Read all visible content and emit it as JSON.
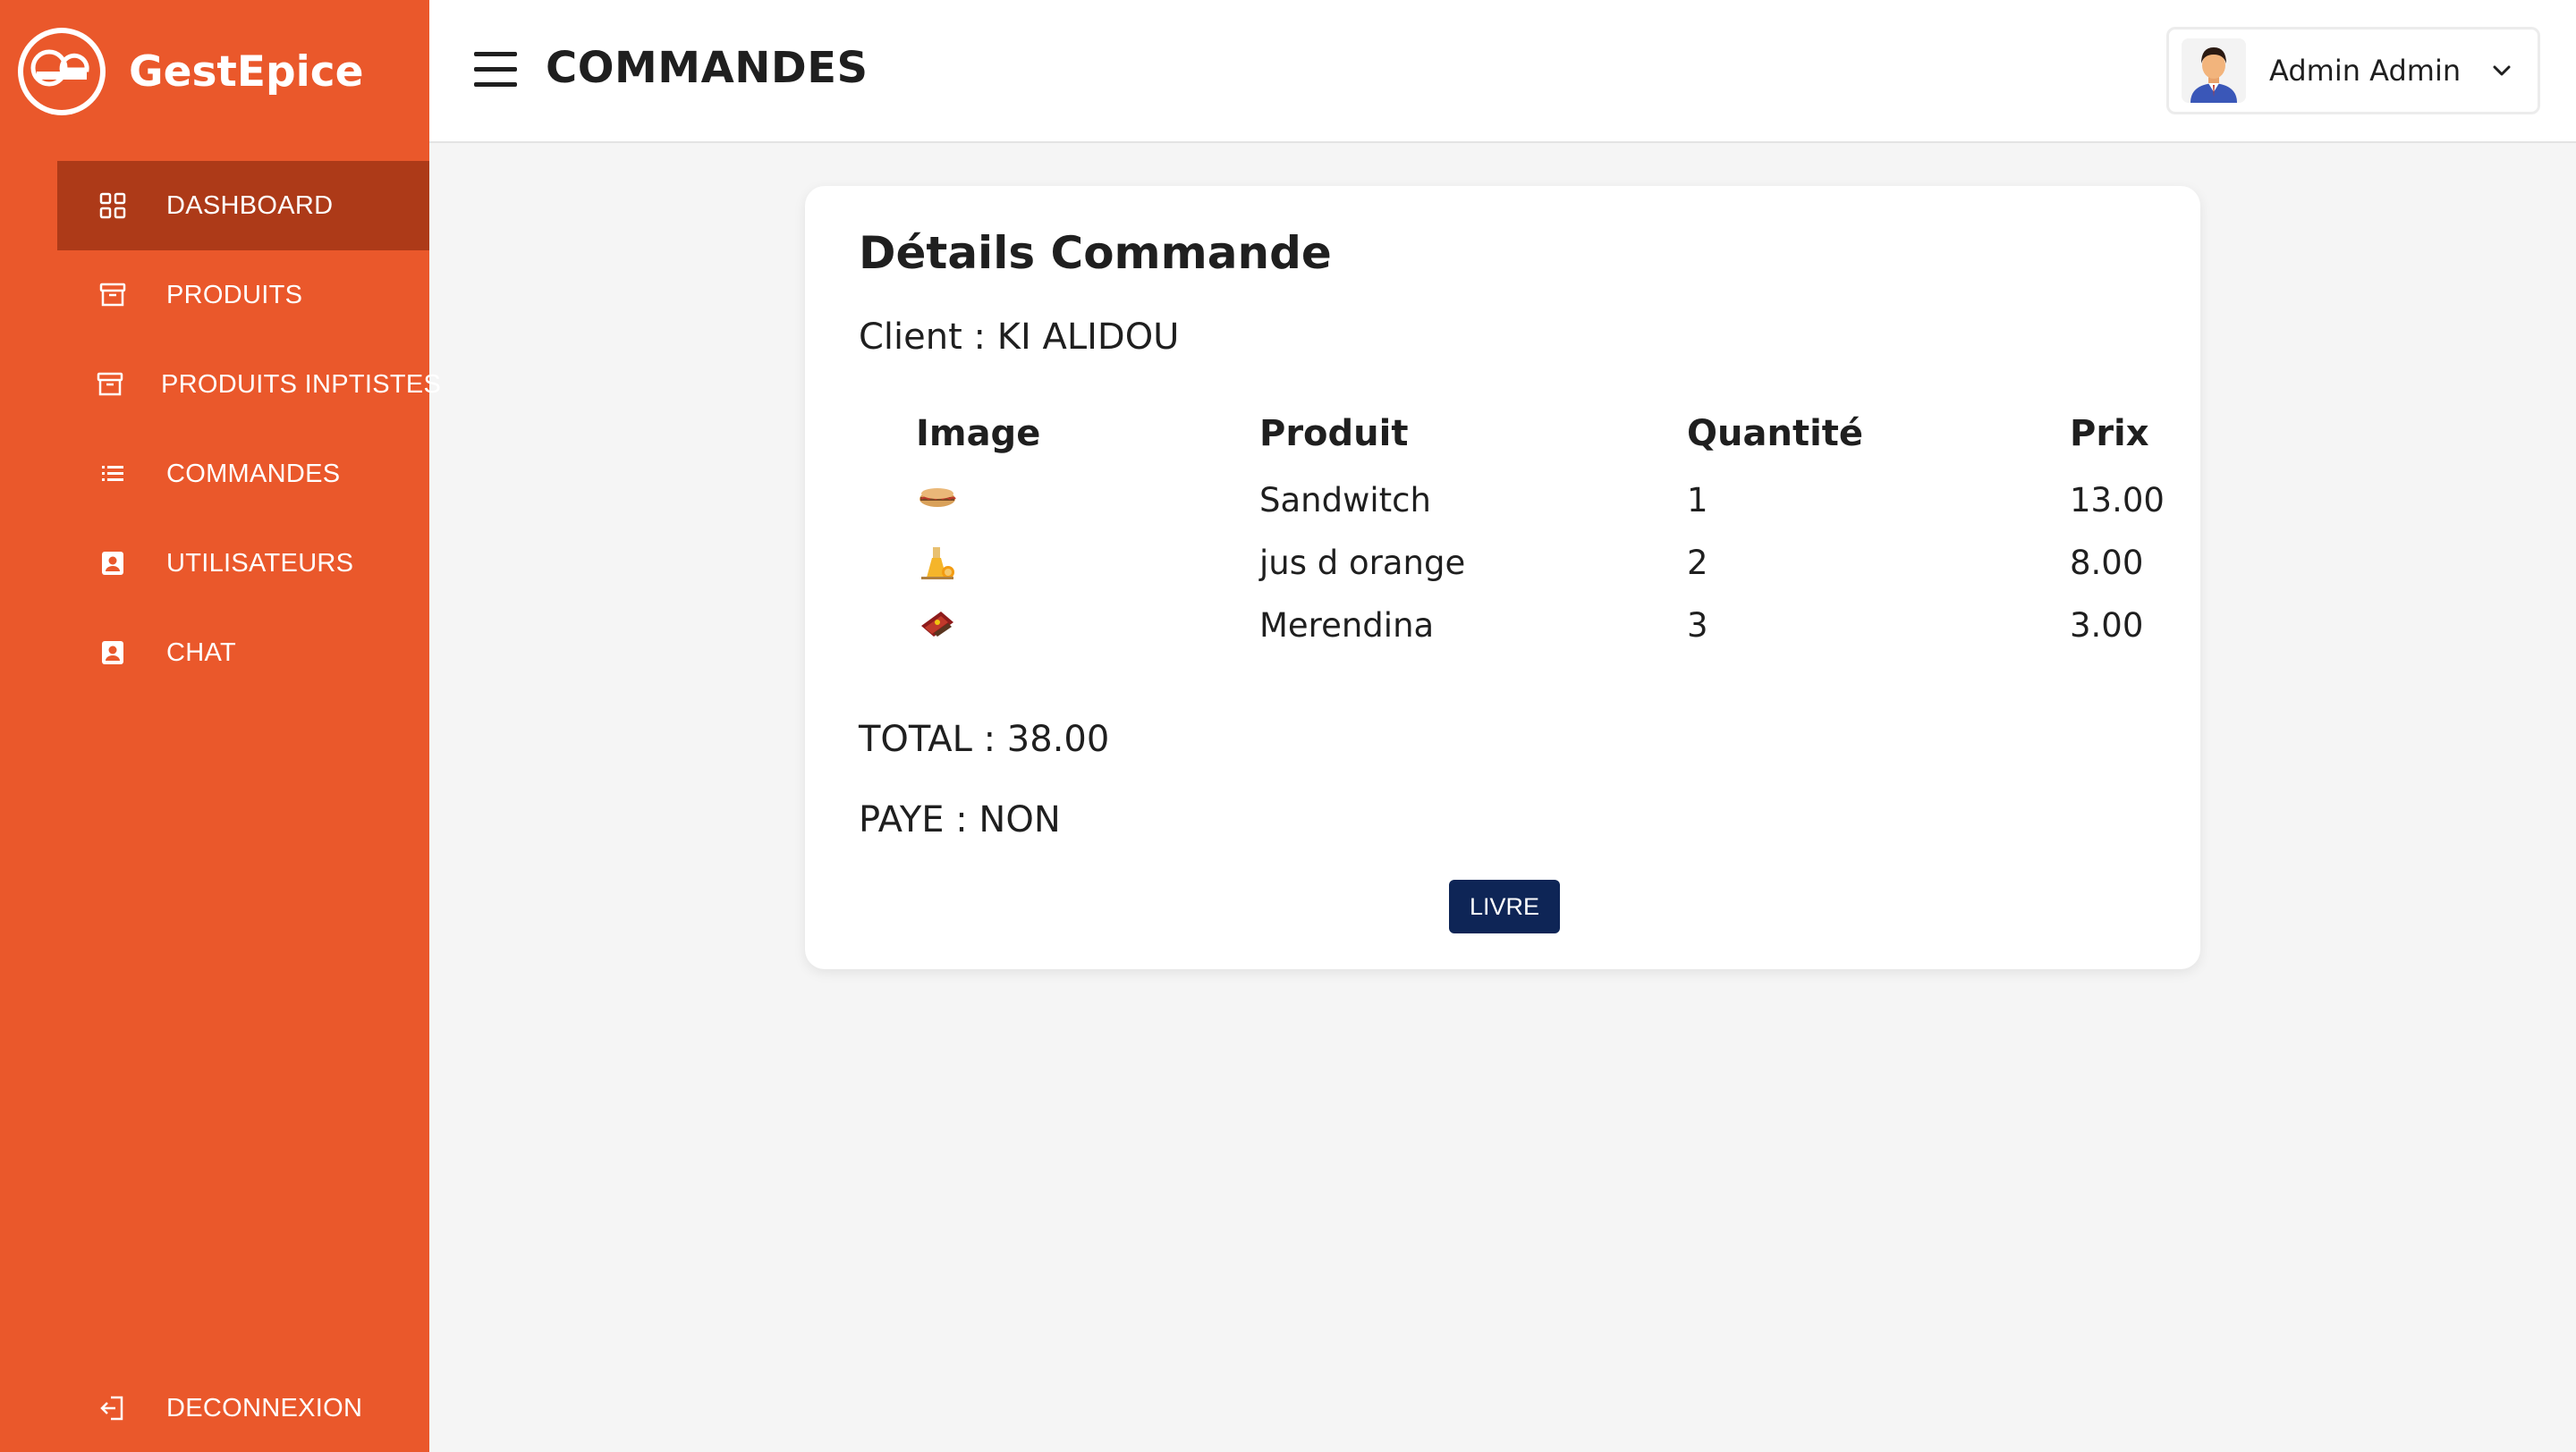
{
  "brand": {
    "name": "GestEpice",
    "logo_text": "GestEpice"
  },
  "sidebar": {
    "items": [
      {
        "label": "DASHBOARD",
        "icon": "grid-icon",
        "active": true
      },
      {
        "label": "PRODUITS",
        "icon": "archive-box-icon"
      },
      {
        "label": "PRODUITS INPTISTES",
        "icon": "archive-box-icon"
      },
      {
        "label": "COMMANDES",
        "icon": "list-icon"
      },
      {
        "label": "UTILISATEURS",
        "icon": "user-card-icon"
      },
      {
        "label": "CHAT",
        "icon": "user-card-icon"
      }
    ],
    "logout": {
      "label": "DECONNEXION",
      "icon": "logout-icon"
    }
  },
  "header": {
    "title": "COMMANDES",
    "user": {
      "name": "Admin Admin",
      "avatar": "admin-avatar"
    }
  },
  "card": {
    "title": "Détails Commande",
    "client": "Client : KI ALIDOU",
    "table": {
      "columns": [
        "Image",
        "Produit",
        "Quantité",
        "Prix"
      ],
      "rows": [
        {
          "image": "sandwich-thumbnail",
          "produit": "Sandwitch",
          "quantite": "1",
          "prix": "13.00"
        },
        {
          "image": "orange-juice-thumbnail",
          "produit": "jus d orange",
          "quantite": "2",
          "prix": "8.00"
        },
        {
          "image": "merendina-thumbnail",
          "produit": "Merendina",
          "quantite": "3",
          "prix": "3.00"
        }
      ]
    },
    "total": "TOTAL : 38.00",
    "paye": "PAYE : NON",
    "button_label": "LIVRE"
  },
  "colors": {
    "sidebar_bg": "#ea582b",
    "sidebar_active": "#ad3a18",
    "button_bg": "#0e2556",
    "page_bg": "#f5f5f5"
  }
}
